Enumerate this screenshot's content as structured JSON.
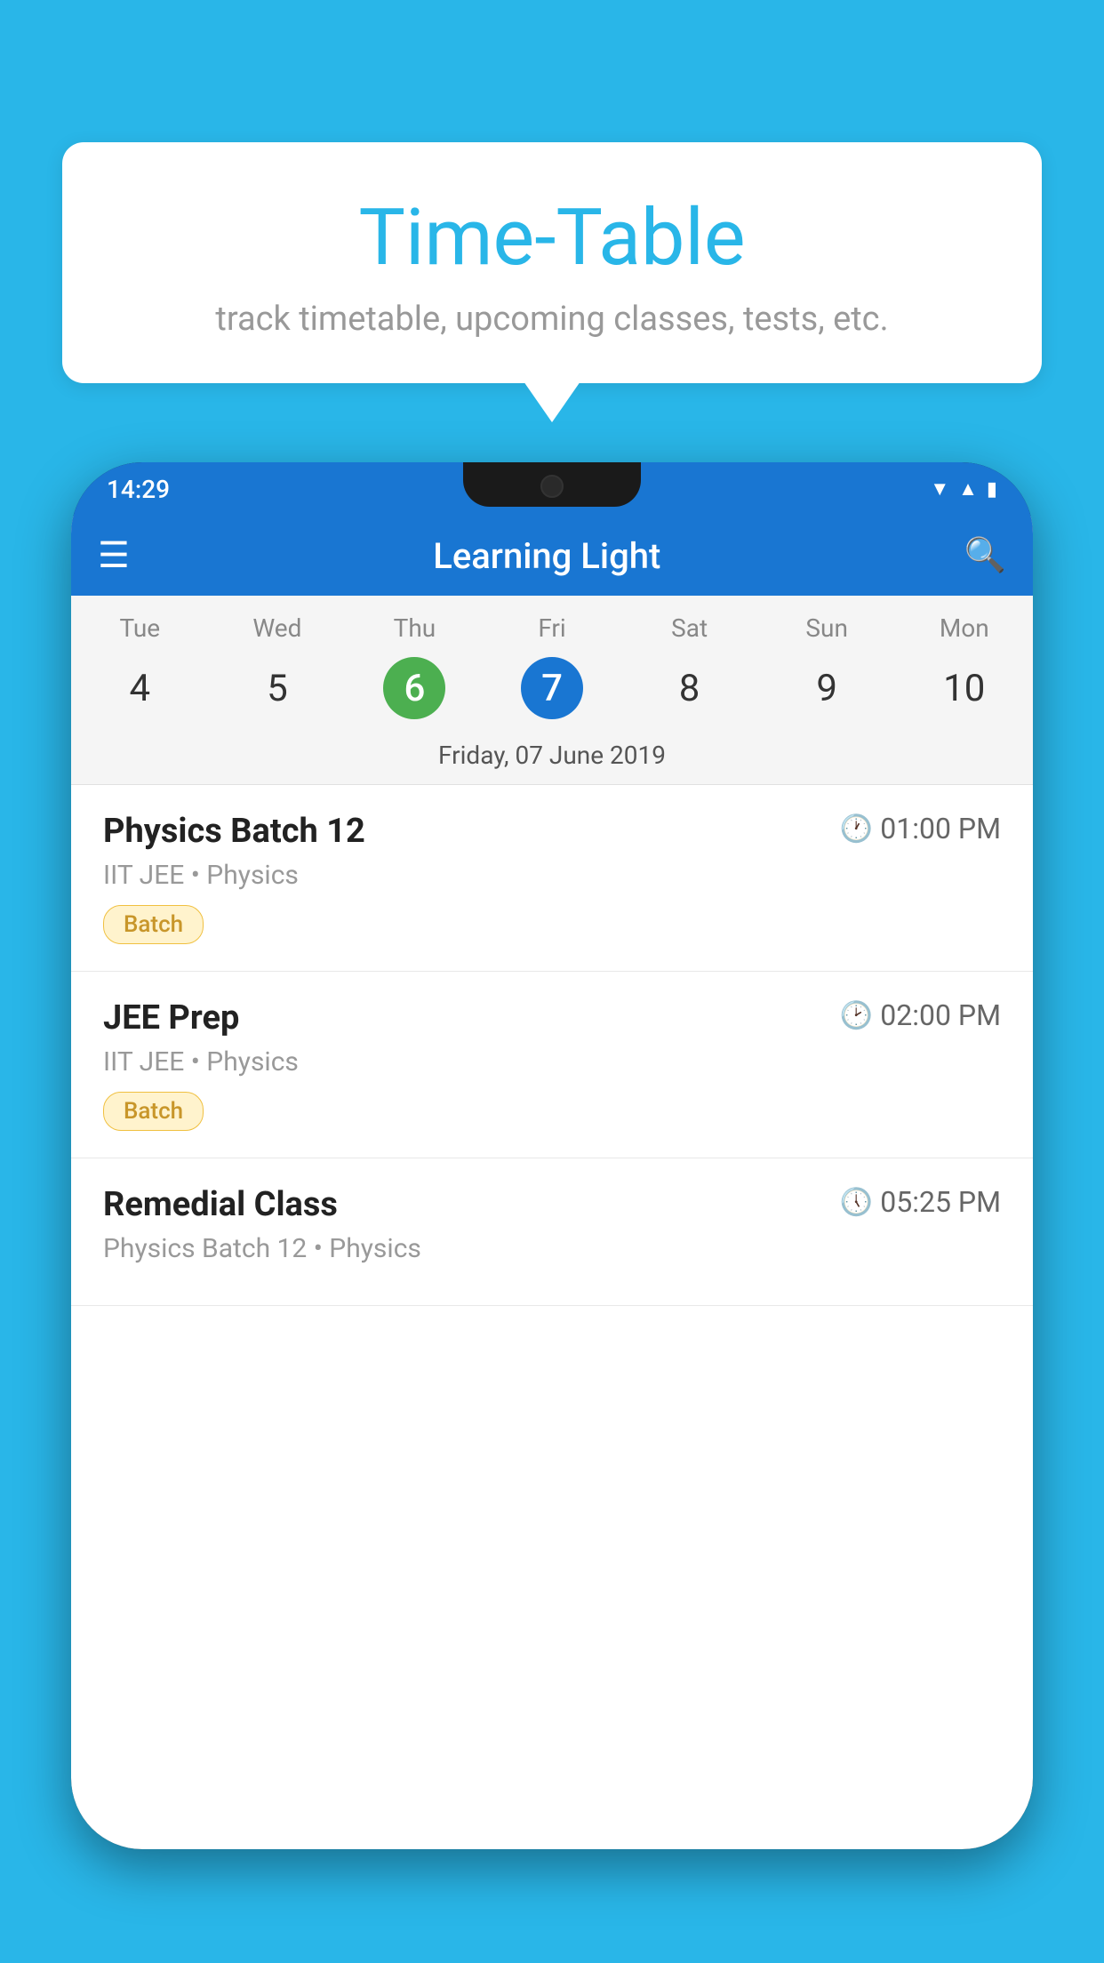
{
  "background_color": "#29b6e8",
  "speech_bubble": {
    "title": "Time-Table",
    "subtitle": "track timetable, upcoming classes, tests, etc."
  },
  "phone": {
    "status_bar": {
      "time": "14:29",
      "icons": [
        "wifi",
        "signal",
        "battery"
      ]
    },
    "app_bar": {
      "title": "Learning Light",
      "menu_icon": "☰",
      "search_icon": "🔍"
    },
    "calendar": {
      "days": [
        {
          "label": "Tue",
          "number": "4"
        },
        {
          "label": "Wed",
          "number": "5"
        },
        {
          "label": "Thu",
          "number": "6",
          "state": "today"
        },
        {
          "label": "Fri",
          "number": "7",
          "state": "selected"
        },
        {
          "label": "Sat",
          "number": "8"
        },
        {
          "label": "Sun",
          "number": "9"
        },
        {
          "label": "Mon",
          "number": "10"
        }
      ],
      "selected_date_label": "Friday, 07 June 2019"
    },
    "schedule": {
      "items": [
        {
          "title": "Physics Batch 12",
          "time": "01:00 PM",
          "subtitle": "IIT JEE • Physics",
          "badge": "Batch"
        },
        {
          "title": "JEE Prep",
          "time": "02:00 PM",
          "subtitle": "IIT JEE • Physics",
          "badge": "Batch"
        },
        {
          "title": "Remedial Class",
          "time": "05:25 PM",
          "subtitle": "Physics Batch 12 • Physics",
          "badge": null
        }
      ]
    }
  }
}
